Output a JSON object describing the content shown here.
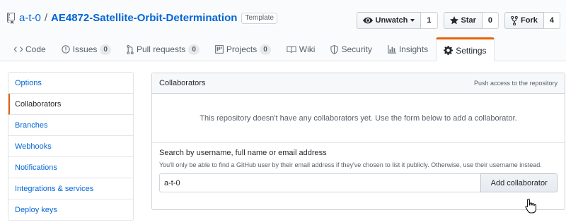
{
  "header": {
    "owner": "a-t-0",
    "separator": "/",
    "repo": "AE4872-Satellite-Orbit-Determination",
    "template_badge": "Template",
    "repo_icon": "repo-template-icon"
  },
  "actions": {
    "watch": {
      "label": "Unwatch",
      "count": "1",
      "icon": "eye-icon"
    },
    "star": {
      "label": "Star",
      "count": "0",
      "icon": "star-icon"
    },
    "fork": {
      "label": "Fork",
      "count": "4",
      "icon": "fork-icon"
    }
  },
  "tabs": [
    {
      "label": "Code",
      "icon": "code-icon"
    },
    {
      "label": "Issues",
      "count": "0",
      "icon": "issue-icon"
    },
    {
      "label": "Pull requests",
      "count": "0",
      "icon": "pull-request-icon"
    },
    {
      "label": "Projects",
      "count": "0",
      "icon": "project-icon"
    },
    {
      "label": "Wiki",
      "icon": "wiki-icon"
    },
    {
      "label": "Security",
      "icon": "shield-icon"
    },
    {
      "label": "Insights",
      "icon": "graph-icon"
    },
    {
      "label": "Settings",
      "icon": "gear-icon",
      "selected": true
    }
  ],
  "sidebar": {
    "items": [
      {
        "label": "Options"
      },
      {
        "label": "Collaborators",
        "selected": true
      },
      {
        "label": "Branches"
      },
      {
        "label": "Webhooks"
      },
      {
        "label": "Notifications"
      },
      {
        "label": "Integrations & services"
      },
      {
        "label": "Deploy keys"
      }
    ]
  },
  "collaborators": {
    "title": "Collaborators",
    "note": "Push access to the repository",
    "empty_message": "This repository doesn't have any collaborators yet. Use the form below to add a collaborator.",
    "search_label": "Search by username, full name or email address",
    "search_note": "You'll only be able to find a GitHub user by their email address if they've chosen to list it publicly. Otherwise, use their username instead.",
    "search_value": "a-t-0",
    "add_button": "Add collaborator"
  },
  "colors": {
    "link": "#0366d6",
    "accent_tab": "#e36209"
  }
}
